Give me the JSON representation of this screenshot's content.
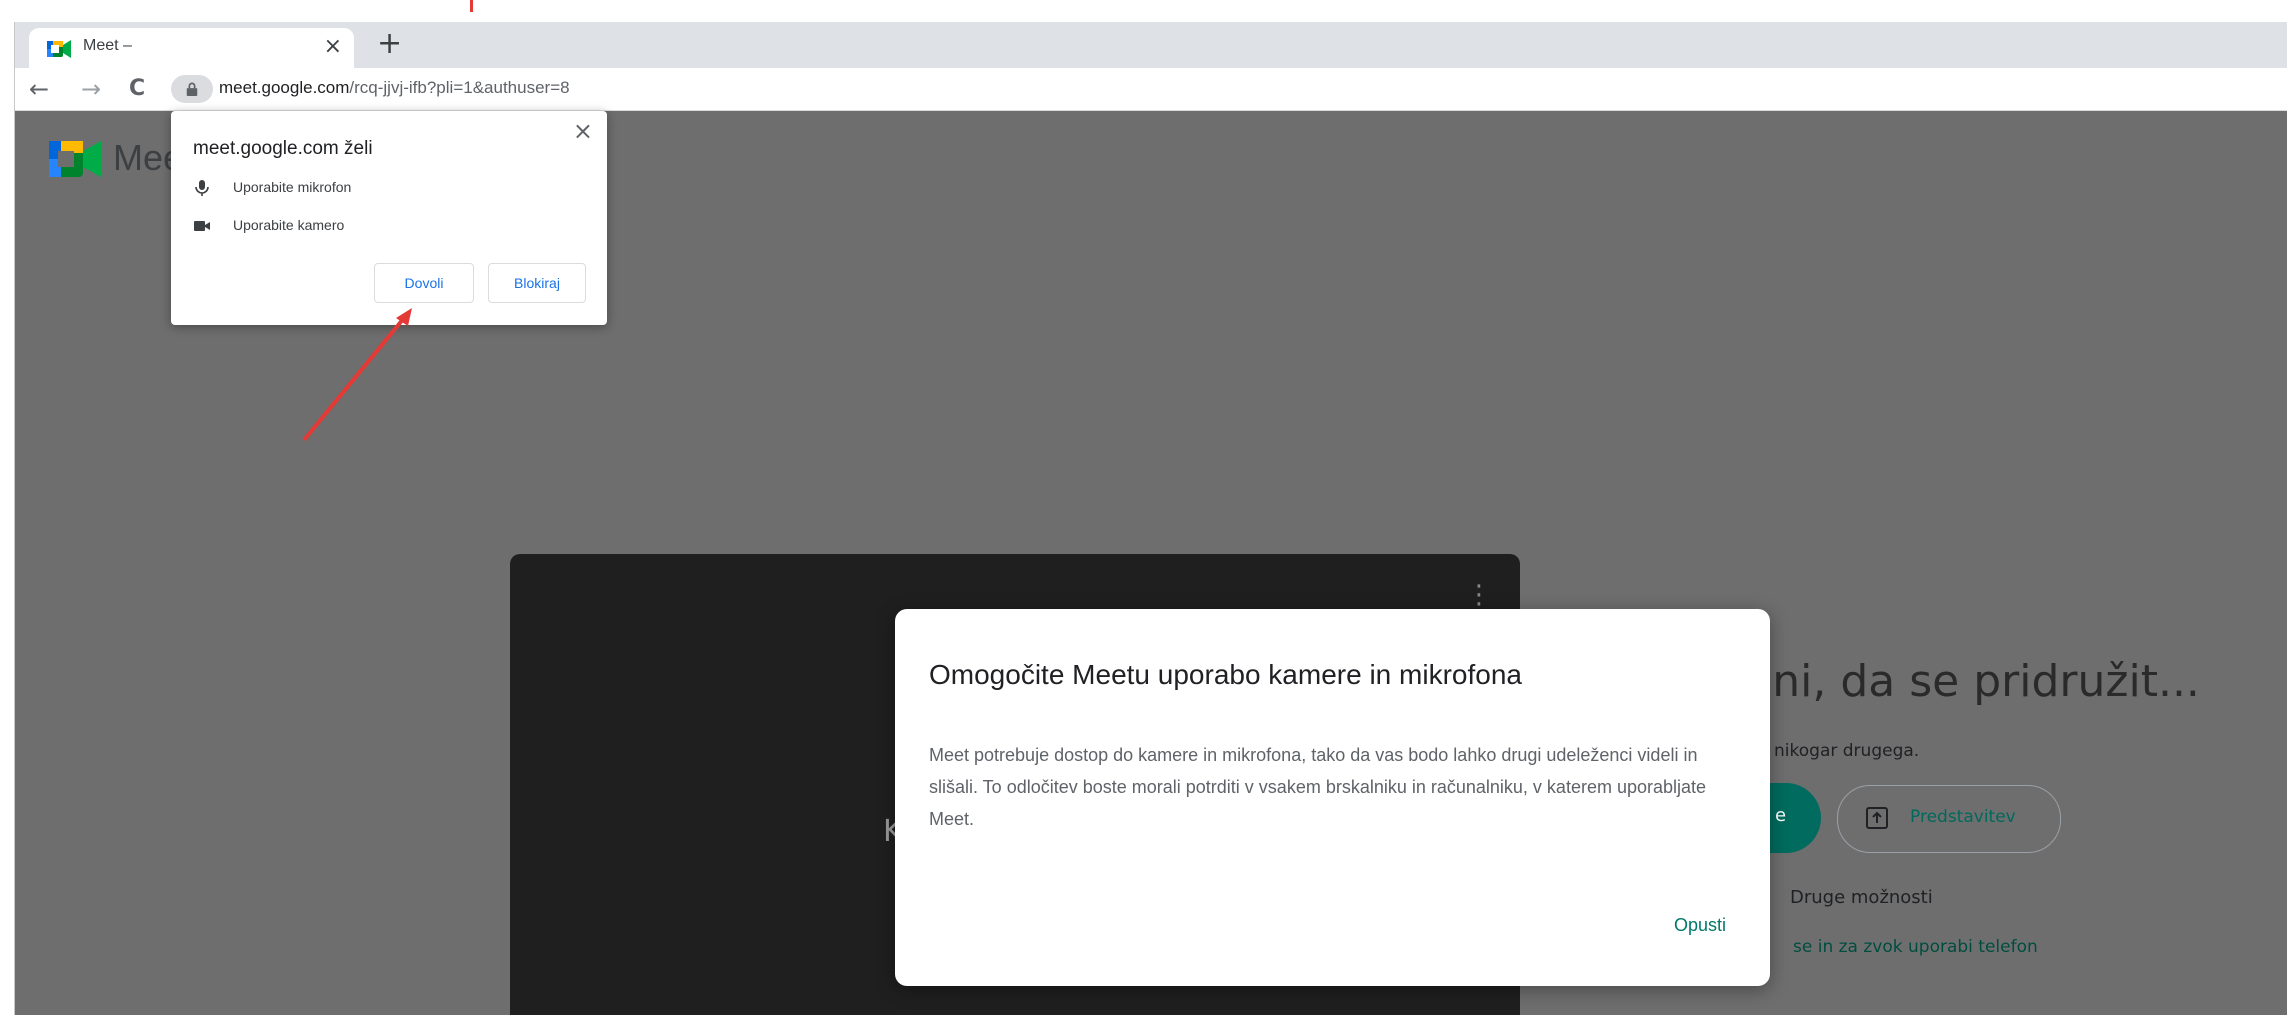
{
  "browser": {
    "tab_title": "Meet –",
    "tab_close": "×",
    "new_tab": "+",
    "nav_back": "←",
    "nav_forward": "→",
    "nav_reload": "C",
    "url_host": "meet.google.com",
    "url_path": "/rcq-jjvj-ifb?pli=1&authuser=8"
  },
  "permission_popup": {
    "title": "meet.google.com želi",
    "close": "×",
    "permissions": [
      {
        "icon": "microphone-icon",
        "label": "Uporabite mikrofon"
      },
      {
        "icon": "camera-icon",
        "label": "Uporabite kamero"
      }
    ],
    "allow_label": "Dovoli",
    "block_label": "Blokiraj"
  },
  "meet": {
    "logo_text": "Mee",
    "video_menu": "⋮",
    "video_letter": "K",
    "ready_text": "jeni, da se pridružit...",
    "nobody_text": "j ni nikogar drugega.",
    "join_label": "e",
    "present_label": "Predstavitev",
    "other_options": "Druge možnosti",
    "phone_option": "se in za zvok uporabi telefon"
  },
  "dialog": {
    "title": "Omogočite Meetu uporabo kamere in mikrofona",
    "body": "Meet potrebuje dostop do kamere in mikrofona, tako da vas bodo lahko drugi udeleženci videli in slišali. To odločitev boste morali potrditi v vsakem brskalniku in računalniku, v katerem uporabljate Meet.",
    "dismiss_label": "Opusti"
  },
  "colors": {
    "meet_accent": "#00796b",
    "chrome_blue": "#1a73e8",
    "annotation_red": "#e53935"
  }
}
